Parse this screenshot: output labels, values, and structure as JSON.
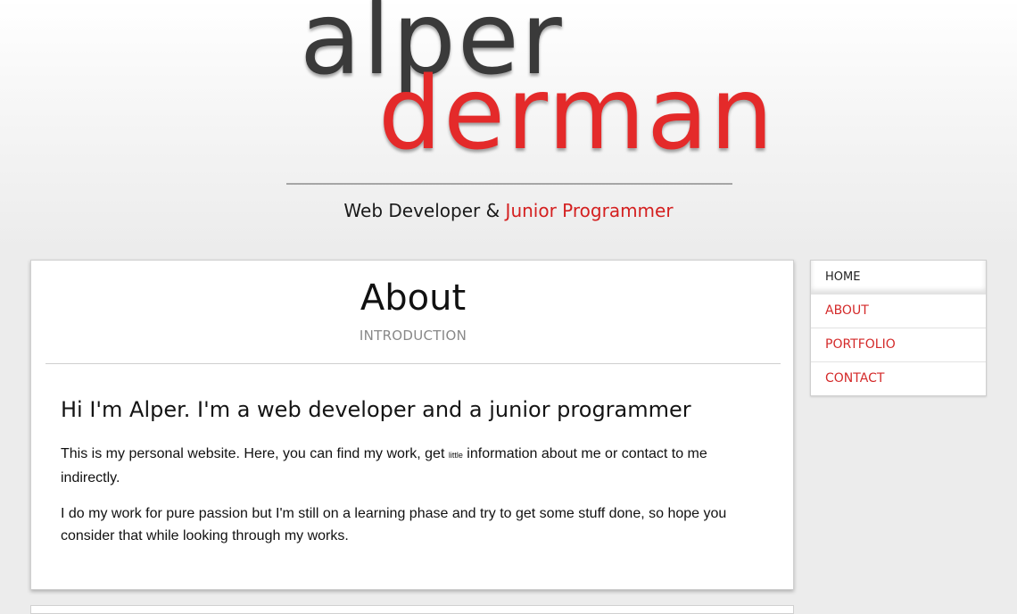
{
  "header": {
    "logo_line1": "alper",
    "logo_line2": "derman",
    "tagline_part1": "Web Developer & ",
    "tagline_accent": "Junior Programmer"
  },
  "main": {
    "title": "About",
    "subtitle": "INTRODUCTION",
    "heading": "Hi I'm Alper. I'm a web developer and a junior programmer",
    "para1_before": "This is my personal website. Here, you can find my work, get ",
    "para1_small": "little",
    "para1_after": " information about me or contact to me indirectly.",
    "para2": "I do my work for pure passion but I'm still on a learning phase and try to get some stuff done, so hope you consider that while looking through my works."
  },
  "nav": {
    "items": [
      {
        "label": "HOME"
      },
      {
        "label": "ABOUT"
      },
      {
        "label": "PORTFOLIO"
      },
      {
        "label": "CONTACT"
      }
    ],
    "active": "HOME"
  },
  "colors": {
    "accent": "#d42020",
    "logo_dark": "#3a3a3a",
    "logo_red": "#e42a2a",
    "background": "#ececec"
  }
}
